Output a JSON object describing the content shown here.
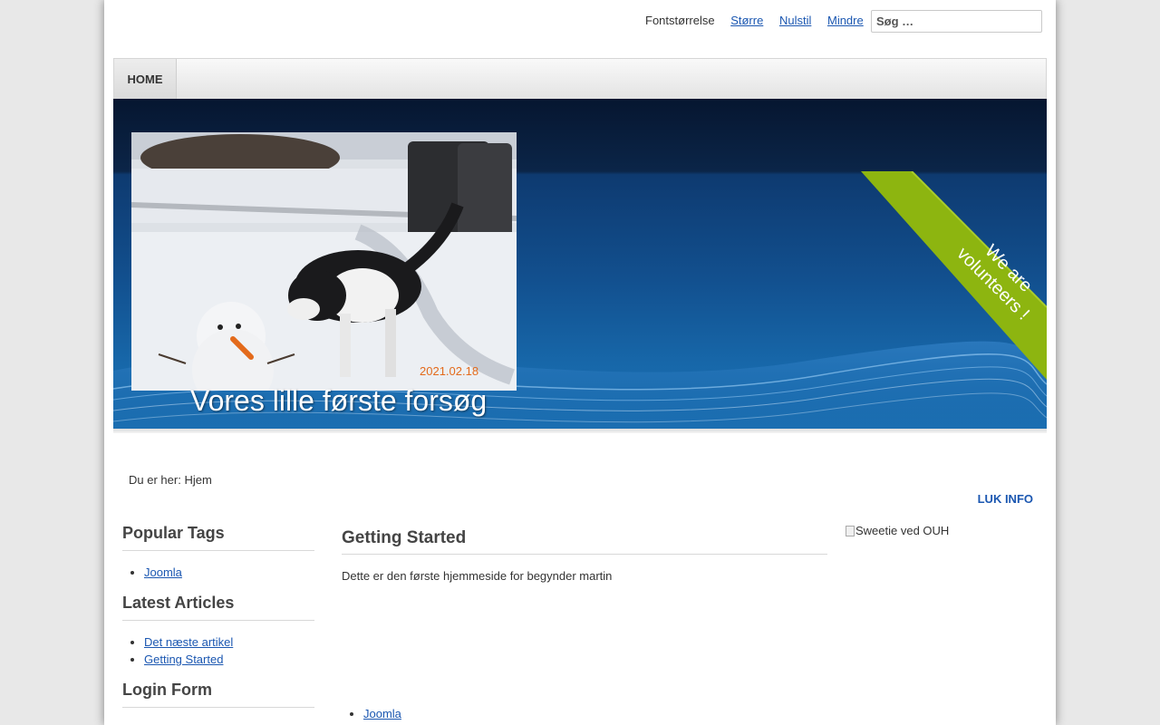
{
  "header": {
    "fontsize_label": "Fontstørrelse",
    "fontsize_larger": "Større",
    "fontsize_reset": "Nulstil",
    "fontsize_smaller": "Mindre",
    "search_placeholder": "Søg …"
  },
  "nav": {
    "items": [
      {
        "label": "HOME"
      }
    ]
  },
  "banner": {
    "site_title": "Vores lille første forsøg",
    "ribbon_line1": "We are",
    "ribbon_line2": "volunteers !",
    "photo_date": "2021.02.18"
  },
  "breadcrumb": {
    "label": "Du er her:",
    "current": "Hjem"
  },
  "close_info": "LUK INFO",
  "sidebar": {
    "modules": [
      {
        "title": "Popular Tags",
        "items": [
          "Joomla"
        ]
      },
      {
        "title": "Latest Articles",
        "items": [
          "Det næste artikel",
          "Getting Started"
        ]
      },
      {
        "title": "Login Form",
        "items": []
      }
    ]
  },
  "article": {
    "title": "Getting Started",
    "body": "Dette er den første hjemmeside for begynder martin",
    "tags": [
      "Joomla"
    ]
  },
  "right": {
    "image_alt": "Sweetie ved OUH"
  },
  "colors": {
    "link": "#1b57b1",
    "ribbon": "#8db510",
    "banner_blue": "#12508f"
  }
}
